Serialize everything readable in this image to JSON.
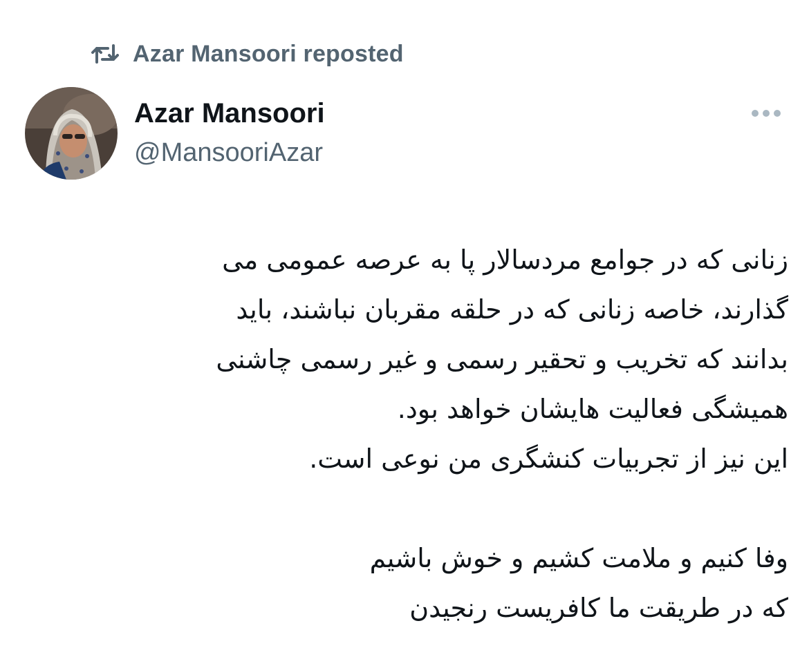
{
  "repost": {
    "text": "Azar Mansoori reposted",
    "icon": "repost-icon"
  },
  "author": {
    "name": "Azar Mansoori",
    "handle": "@MansooriAzar",
    "avatar": "avatar-photo"
  },
  "menu": {
    "icon": "more-horizontal-icon"
  },
  "tweet": {
    "lines": [
      "زنانی که در جوامع مردسالار پا به عرصه عمومی می",
      "گذارند، خاصه زنانی که در حلقه مقربان نباشند، باید",
      "بدانند که تخریب و تحقیر رسمی و غیر رسمی چاشنی",
      "همیشگی فعالیت هایشان خواهد بود.",
      "این نیز از تجربیات کنشگری من نوعی است.",
      "",
      "وفا کنیم و ملامت کشیم و خوش باشیم",
      "که در طریقت ما کافریست رنجیدن"
    ]
  },
  "colors": {
    "primary_text": "#0f1419",
    "secondary_text": "#536471",
    "background": "#ffffff"
  }
}
